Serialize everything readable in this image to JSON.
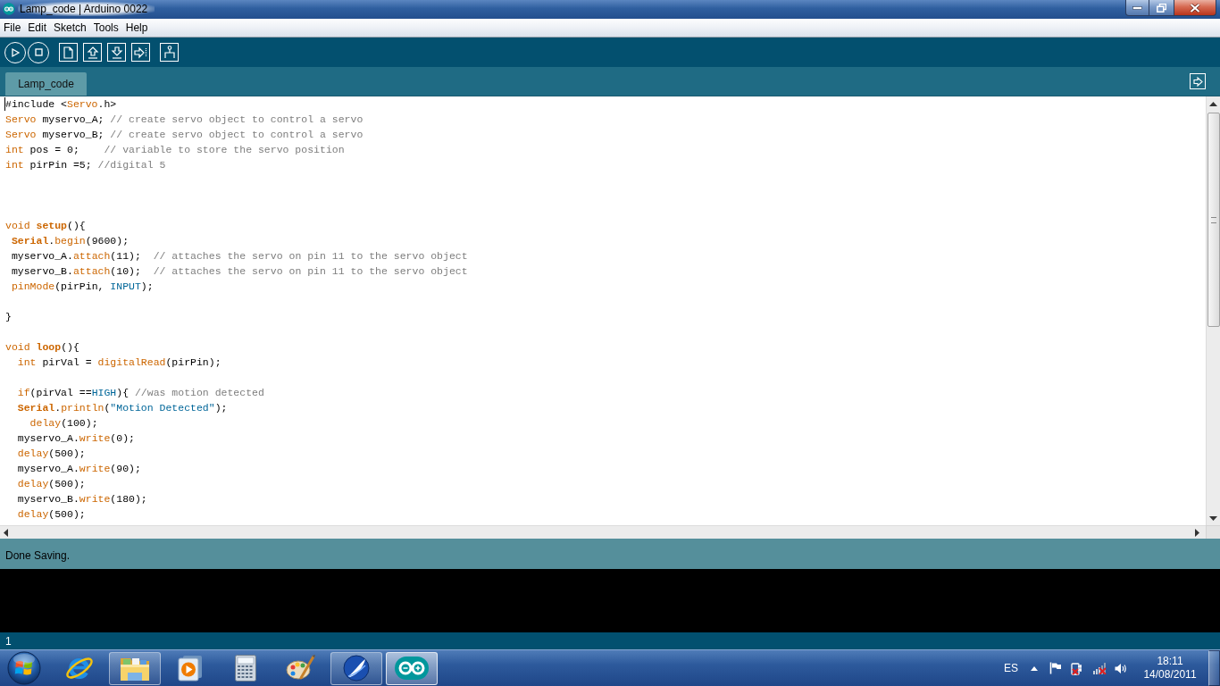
{
  "window": {
    "title": "Lamp_code | Arduino 0022"
  },
  "menu": [
    "File",
    "Edit",
    "Sketch",
    "Tools",
    "Help"
  ],
  "tabs": [
    {
      "label": "Lamp_code",
      "selected": true
    }
  ],
  "editor": {
    "lines": [
      {
        "kind": "code",
        "tokens": [
          {
            "kind": "plain",
            "text": "#include <"
          },
          {
            "kind": "type",
            "text": "Servo"
          },
          {
            "kind": "plain",
            "text": ".h>"
          }
        ]
      },
      {
        "kind": "code",
        "tokens": [
          {
            "kind": "type",
            "text": "Servo"
          },
          {
            "kind": "plain",
            "text": " myservo_A; "
          },
          {
            "kind": "comment",
            "text": "// create servo object to control a servo"
          }
        ]
      },
      {
        "kind": "code",
        "tokens": [
          {
            "kind": "type",
            "text": "Servo"
          },
          {
            "kind": "plain",
            "text": " myservo_B; "
          },
          {
            "kind": "comment",
            "text": "// create servo object to control a servo"
          }
        ]
      },
      {
        "kind": "code",
        "tokens": [
          {
            "kind": "type",
            "text": "int"
          },
          {
            "kind": "plain",
            "text": " pos = 0;    "
          },
          {
            "kind": "comment",
            "text": "// variable to store the servo position"
          }
        ]
      },
      {
        "kind": "code",
        "tokens": [
          {
            "kind": "type",
            "text": "int"
          },
          {
            "kind": "plain",
            "text": " pirPin =5; "
          },
          {
            "kind": "comment",
            "text": "//digital 5"
          }
        ]
      },
      {
        "kind": "blank"
      },
      {
        "kind": "blank"
      },
      {
        "kind": "blank"
      },
      {
        "kind": "code",
        "tokens": [
          {
            "kind": "type",
            "text": "void "
          },
          {
            "kind": "structure",
            "text": "setup"
          },
          {
            "kind": "plain",
            "text": "(){"
          }
        ]
      },
      {
        "kind": "code",
        "tokens": [
          {
            "kind": "structure",
            "text": " Serial"
          },
          {
            "kind": "plain",
            "text": "."
          },
          {
            "kind": "function",
            "text": "begin"
          },
          {
            "kind": "plain",
            "text": "(9600);"
          }
        ]
      },
      {
        "kind": "code",
        "tokens": [
          {
            "kind": "plain",
            "text": " myservo_A."
          },
          {
            "kind": "function",
            "text": "attach"
          },
          {
            "kind": "plain",
            "text": "(11);  "
          },
          {
            "kind": "comment",
            "text": "// attaches the servo on pin 11 to the servo object"
          }
        ]
      },
      {
        "kind": "code",
        "tokens": [
          {
            "kind": "plain",
            "text": " myservo_B."
          },
          {
            "kind": "function",
            "text": "attach"
          },
          {
            "kind": "plain",
            "text": "(10);  "
          },
          {
            "kind": "comment",
            "text": "// attaches the servo on pin 11 to the servo object"
          }
        ]
      },
      {
        "kind": "code",
        "tokens": [
          {
            "kind": "function",
            "text": " pinMode"
          },
          {
            "kind": "plain",
            "text": "(pirPin, "
          },
          {
            "kind": "constant",
            "text": "INPUT"
          },
          {
            "kind": "plain",
            "text": ");"
          }
        ]
      },
      {
        "kind": "blank"
      },
      {
        "kind": "code",
        "tokens": [
          {
            "kind": "plain",
            "text": "}"
          }
        ]
      },
      {
        "kind": "blank"
      },
      {
        "kind": "code",
        "tokens": [
          {
            "kind": "type",
            "text": "void "
          },
          {
            "kind": "structure",
            "text": "loop"
          },
          {
            "kind": "plain",
            "text": "(){"
          }
        ]
      },
      {
        "kind": "code",
        "tokens": [
          {
            "kind": "type",
            "text": "  int"
          },
          {
            "kind": "plain",
            "text": " pirVal = "
          },
          {
            "kind": "function",
            "text": "digitalRead"
          },
          {
            "kind": "plain",
            "text": "(pirPin);"
          }
        ]
      },
      {
        "kind": "blank"
      },
      {
        "kind": "code",
        "tokens": [
          {
            "kind": "type",
            "text": "  if"
          },
          {
            "kind": "plain",
            "text": "(pirVal =="
          },
          {
            "kind": "constant",
            "text": "HIGH"
          },
          {
            "kind": "plain",
            "text": "){ "
          },
          {
            "kind": "comment",
            "text": "//was motion detected"
          }
        ]
      },
      {
        "kind": "code",
        "tokens": [
          {
            "kind": "structure",
            "text": "  Serial"
          },
          {
            "kind": "plain",
            "text": "."
          },
          {
            "kind": "function",
            "text": "println"
          },
          {
            "kind": "plain",
            "text": "("
          },
          {
            "kind": "string",
            "text": "\"Motion Detected\""
          },
          {
            "kind": "plain",
            "text": ");"
          }
        ]
      },
      {
        "kind": "code",
        "tokens": [
          {
            "kind": "function",
            "text": "    delay"
          },
          {
            "kind": "plain",
            "text": "(100);"
          }
        ]
      },
      {
        "kind": "code",
        "tokens": [
          {
            "kind": "plain",
            "text": "  myservo_A."
          },
          {
            "kind": "function",
            "text": "write"
          },
          {
            "kind": "plain",
            "text": "(0);"
          }
        ]
      },
      {
        "kind": "code",
        "tokens": [
          {
            "kind": "function",
            "text": "  delay"
          },
          {
            "kind": "plain",
            "text": "(500);"
          }
        ]
      },
      {
        "kind": "code",
        "tokens": [
          {
            "kind": "plain",
            "text": "  myservo_A."
          },
          {
            "kind": "function",
            "text": "write"
          },
          {
            "kind": "plain",
            "text": "(90);"
          }
        ]
      },
      {
        "kind": "code",
        "tokens": [
          {
            "kind": "function",
            "text": "  delay"
          },
          {
            "kind": "plain",
            "text": "(500);"
          }
        ]
      },
      {
        "kind": "code",
        "tokens": [
          {
            "kind": "plain",
            "text": "  myservo_B."
          },
          {
            "kind": "function",
            "text": "write"
          },
          {
            "kind": "plain",
            "text": "(180);"
          }
        ]
      },
      {
        "kind": "code",
        "tokens": [
          {
            "kind": "function",
            "text": "  delay"
          },
          {
            "kind": "plain",
            "text": "(500);"
          }
        ]
      }
    ]
  },
  "status": {
    "message": "Done Saving."
  },
  "line_number": "1",
  "taskbar": {
    "apps": [
      {
        "kind": "browser",
        "running": false,
        "selected": false
      },
      {
        "kind": "folder",
        "running": true,
        "selected": false
      },
      {
        "kind": "media",
        "running": false,
        "selected": false
      },
      {
        "kind": "calculator",
        "running": false,
        "selected": false
      },
      {
        "kind": "paint",
        "running": false,
        "selected": false
      },
      {
        "kind": "swoosh",
        "running": true,
        "selected": false
      },
      {
        "kind": "arduino",
        "running": true,
        "selected": true
      }
    ],
    "language": "ES",
    "time": "18:11",
    "date": "14/08/2011"
  }
}
